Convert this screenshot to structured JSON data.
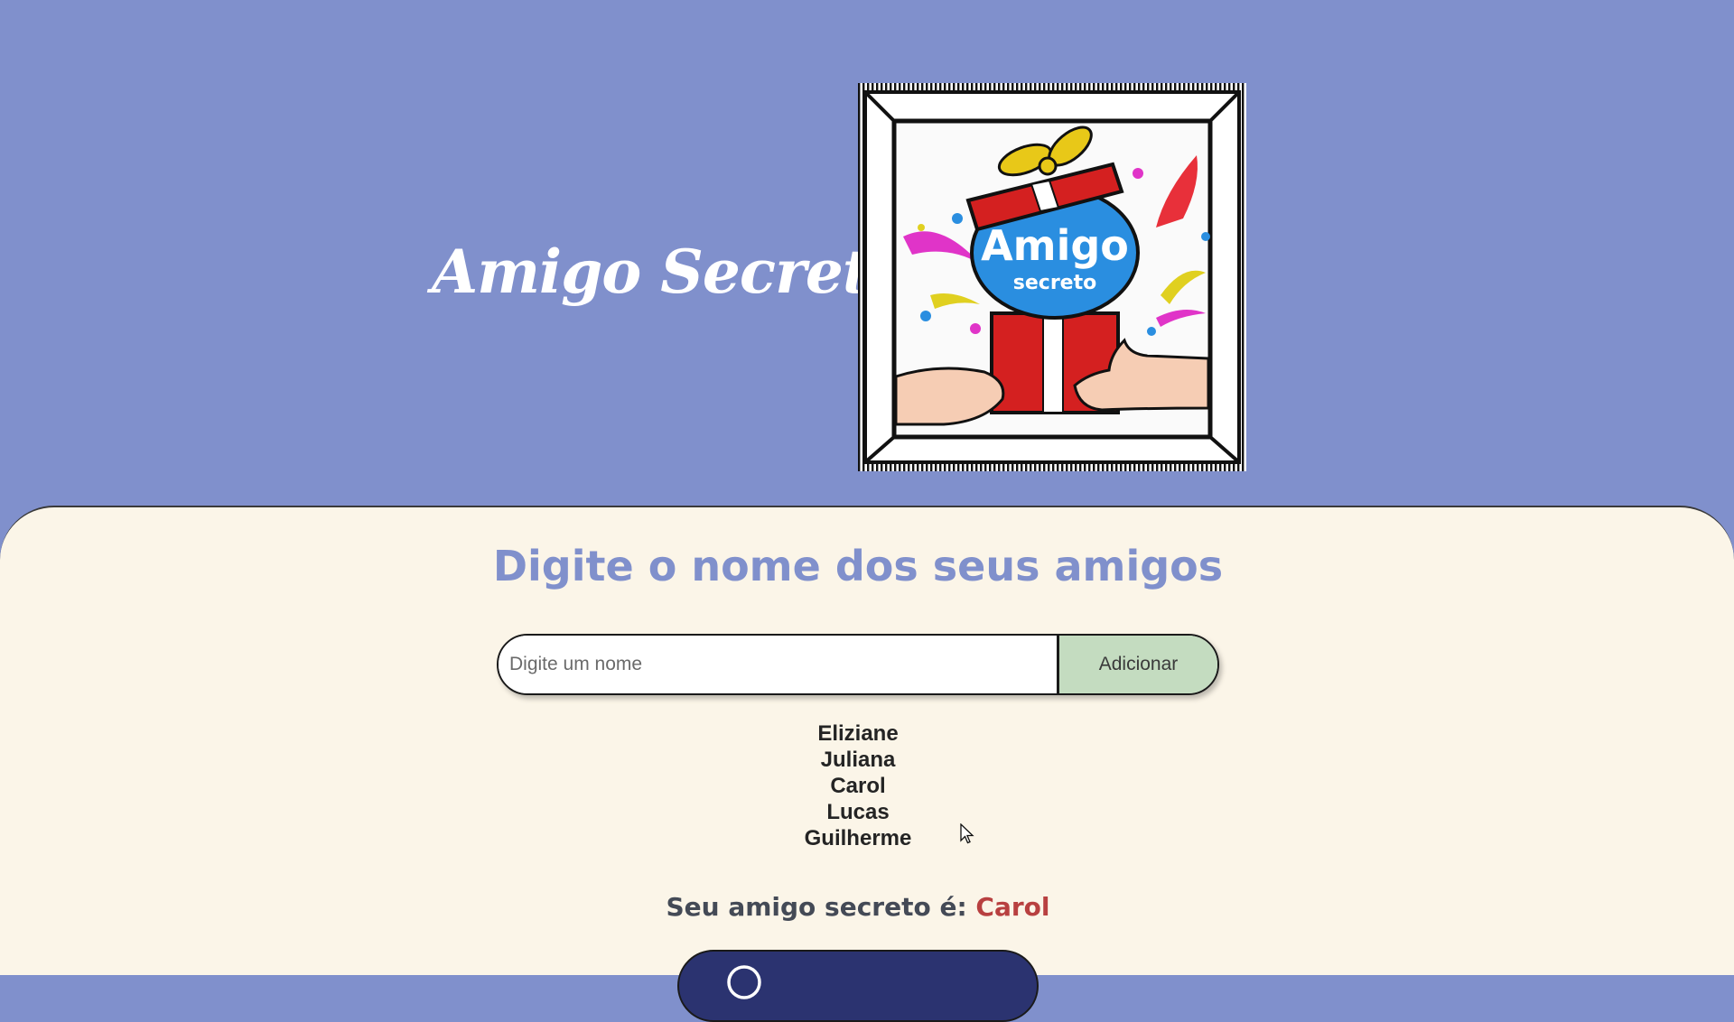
{
  "header": {
    "title": "Amigo Secreto",
    "logo": {
      "icon": "gift-exchange-logo",
      "text_line1": "Amigo",
      "text_line2": "secreto"
    }
  },
  "main": {
    "heading": "Digite o nome dos seus amigos",
    "input": {
      "placeholder": "Digite um nome",
      "value": ""
    },
    "add_button_label": "Adicionar",
    "friends": [
      "Eliziane",
      "Juliana",
      "Carol",
      "Lucas",
      "Guilherme"
    ],
    "result": {
      "label": "Seu amigo secreto é:",
      "name": "Carol"
    },
    "draw_button": {
      "icon": "play-circle-icon"
    }
  },
  "colors": {
    "header_bg": "#8090cc",
    "panel_bg": "#fbf5e8",
    "heading": "#8090cc",
    "add_button_bg": "#c4dcc0",
    "result_name": "#b84040",
    "draw_button_bg": "#2b3370"
  }
}
